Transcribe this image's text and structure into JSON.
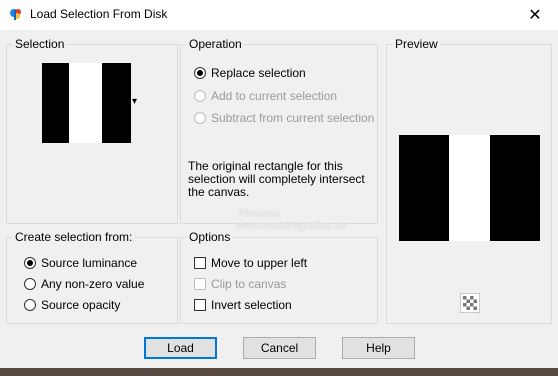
{
  "window": {
    "title": "Load Selection From Disk",
    "close_glyph": "✕"
  },
  "selection_group": {
    "label": "Selection",
    "dropdown_glyph": "▾"
  },
  "operation_group": {
    "label": "Operation",
    "options": [
      {
        "label": "Replace selection",
        "checked": true,
        "enabled": true
      },
      {
        "label": "Add to current selection",
        "checked": false,
        "enabled": false
      },
      {
        "label": "Subtract from current selection",
        "checked": false,
        "enabled": false
      }
    ],
    "note_line1": "The original rectangle for this",
    "note_line2": "selection will completely intersect",
    "note_line3": "the canvas."
  },
  "preview_group": {
    "label": "Preview"
  },
  "create_group": {
    "label": "Create selection from:",
    "options": [
      {
        "label": "Source luminance",
        "checked": true
      },
      {
        "label": "Any non-zero value",
        "checked": false
      },
      {
        "label": "Source opacity",
        "checked": false
      }
    ]
  },
  "options_group": {
    "label": "Options",
    "move_to_upper_left": "Move to upper left",
    "clip_to_canvas": "Clip to canvas",
    "invert_selection": "Invert selection"
  },
  "buttons": {
    "load": "Load",
    "cancel": "Cancel",
    "help": "Help"
  },
  "watermark": {
    "line1": "Pinuccia",
    "line2": "www.maidiregrafica.eu"
  },
  "colors": {
    "accent": "#0078d7",
    "black": "#000000",
    "white": "#ffffff"
  },
  "icons": {
    "app": "paintshop-icon",
    "close": "close-icon",
    "dropdown": "dropdown-arrow-icon",
    "preview_toggle": "checkerboard-icon"
  }
}
